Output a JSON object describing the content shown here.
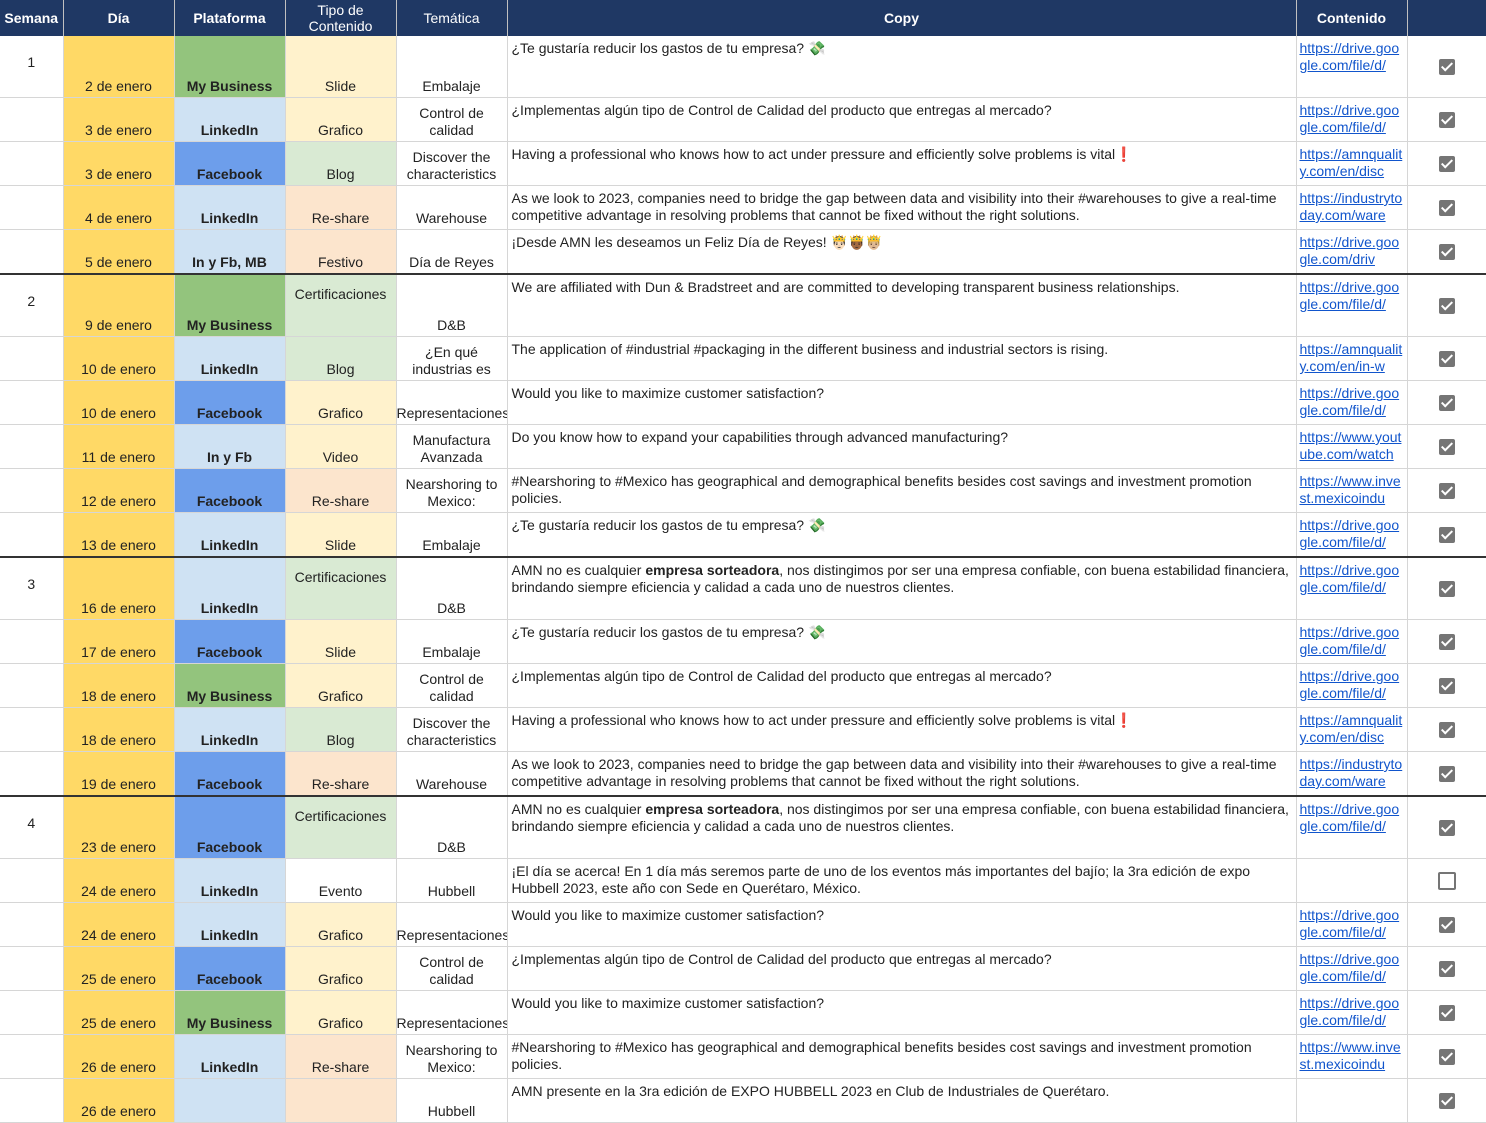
{
  "colors": {
    "header_bg": "#1f3864",
    "day_bg": "#ffd966",
    "my_business": "#93c47d",
    "linkedin": "#cfe2f3",
    "facebook": "#6d9eeb",
    "tipo_yellow": "#fff2cc",
    "tipo_green": "#d9ead3",
    "tipo_orange": "#fce5cd",
    "link": "#1155cc"
  },
  "headers": {
    "semana": "Semana",
    "dia": "Día",
    "plataforma": "Plataforma",
    "tipo": "Tipo de Contenido",
    "tematica": "Temática",
    "copy": "Copy",
    "contenido": "Contenido"
  },
  "rows": [
    {
      "semana": "1",
      "dia": "2 de enero",
      "plataforma": "My Business",
      "plat_color": "#93c47d",
      "tipo": "Slide",
      "tipo_color": "#fff2cc",
      "tematica": "Embalaje",
      "copy": "¿Te gustaría reducir los gastos de tu empresa? 💸",
      "contenido": "https://drive.google.com/file/d/",
      "checked": true
    },
    {
      "semana": "",
      "dia": "3 de enero",
      "plataforma": "LinkedIn",
      "plat_color": "#cfe2f3",
      "tipo": "Grafico",
      "tipo_color": "#fff2cc",
      "tematica": "Control de calidad",
      "copy": "¿Implementas algún tipo de Control de Calidad del producto que entregas al mercado?",
      "contenido": "https://drive.google.com/file/d/",
      "checked": true
    },
    {
      "semana": "",
      "dia": "3 de enero",
      "plataforma": "Facebook",
      "plat_color": "#6d9eeb",
      "tipo": "Blog",
      "tipo_color": "#d9ead3",
      "tematica": "Discover the characteristics",
      "copy": "Having a professional who knows how to act under pressure and efficiently solve problems is vital❗",
      "contenido": "https://amnquality.com/en/disc",
      "checked": true
    },
    {
      "semana": "",
      "dia": "4 de enero",
      "plataforma": "LinkedIn",
      "plat_color": "#cfe2f3",
      "tipo": "Re-share",
      "tipo_color": "#fce5cd",
      "tematica": "Warehouse",
      "copy": "As we look to 2023, companies need to bridge the gap between data and visibility into their #warehouses to give a real-time competitive advantage in resolving problems that cannot be fixed without the right solutions.",
      "contenido": "https://industrytoday.com/ware",
      "checked": true
    },
    {
      "semana": "",
      "dia": "5 de enero",
      "plataforma": "In y Fb, MB",
      "plat_color": "#cfe2f3",
      "tipo": "Festivo",
      "tipo_color": "#fce5cd",
      "tematica": "Día de Reyes",
      "copy": "¡Desde AMN les deseamos un Feliz Día de Reyes! 🤴🏻🤴🏾🤴🏼",
      "contenido": "https://drive.google.com/driv",
      "checked": true
    },
    {
      "semana": "2",
      "dia": "9 de enero",
      "plataforma": "My Business",
      "plat_color": "#93c47d",
      "tipo": "Certificaciones",
      "tipo_color": "#d9ead3",
      "tematica": "D&B",
      "copy": "We are affiliated with Dun & Bradstreet and are committed to developing transparent business relationships.",
      "contenido": "https://drive.google.com/file/d/",
      "checked": true
    },
    {
      "semana": "",
      "dia": "10 de enero",
      "plataforma": "LinkedIn",
      "plat_color": "#cfe2f3",
      "tipo": "Blog",
      "tipo_color": "#d9ead3",
      "tematica": "¿En qué industrias es",
      "copy": "The application of #industrial #packaging in the different business and industrial sectors is rising.",
      "contenido": "https://amnquality.com/en/in-w",
      "checked": true
    },
    {
      "semana": "",
      "dia": "10 de enero",
      "plataforma": "Facebook",
      "plat_color": "#6d9eeb",
      "tipo": "Grafico",
      "tipo_color": "#fff2cc",
      "tematica": "Representaciones",
      "copy": "Would you like to maximize customer satisfaction?",
      "contenido": "https://drive.google.com/file/d/",
      "checked": true
    },
    {
      "semana": "",
      "dia": "11 de enero",
      "plataforma": "In y Fb",
      "plat_color": "#cfe2f3",
      "tipo": "Video",
      "tipo_color": "#fff2cc",
      "tematica": "Manufactura Avanzada",
      "copy": "Do you know how to expand your capabilities through advanced manufacturing?",
      "contenido": "https://www.youtube.com/watch",
      "checked": true
    },
    {
      "semana": "",
      "dia": "12 de enero",
      "plataforma": "Facebook",
      "plat_color": "#6d9eeb",
      "tipo": "Re-share",
      "tipo_color": "#fce5cd",
      "tematica": "Nearshoring to Mexico:",
      "copy": "#Nearshoring to #Mexico has geographical and demographical benefits besides cost savings and investment promotion policies.",
      "contenido": "https://www.invest.mexicoindu",
      "checked": true
    },
    {
      "semana": "",
      "dia": "13 de enero",
      "plataforma": "LinkedIn",
      "plat_color": "#cfe2f3",
      "tipo": "Slide",
      "tipo_color": "#fff2cc",
      "tematica": "Embalaje",
      "copy": "¿Te gustaría reducir los gastos de tu empresa? 💸",
      "contenido": "https://drive.google.com/file/d/",
      "checked": true
    },
    {
      "semana": "3",
      "dia": "16 de enero",
      "plataforma": "LinkedIn",
      "plat_color": "#cfe2f3",
      "tipo": "Certificaciones",
      "tipo_color": "#d9ead3",
      "tematica": "D&B",
      "copy_pre": "AMN no es cualquier ",
      "copy_bold": "empresa sorteadora",
      "copy_post": ", nos distingimos por ser una empresa confiable, con buena estabilidad financiera, brindando siempre eficiencia y calidad a cada uno de nuestros clientes.",
      "contenido": "https://drive.google.com/file/d/",
      "checked": true
    },
    {
      "semana": "",
      "dia": "17 de enero",
      "plataforma": "Facebook",
      "plat_color": "#6d9eeb",
      "tipo": "Slide",
      "tipo_color": "#fff2cc",
      "tematica": "Embalaje",
      "copy": "¿Te gustaría reducir los gastos de tu empresa? 💸",
      "contenido": "https://drive.google.com/file/d/",
      "checked": true
    },
    {
      "semana": "",
      "dia": "18 de enero",
      "plataforma": "My Business",
      "plat_color": "#93c47d",
      "tipo": "Grafico",
      "tipo_color": "#fff2cc",
      "tematica": "Control de calidad",
      "copy": "¿Implementas algún tipo de Control de Calidad del producto que entregas al mercado?",
      "contenido": "https://drive.google.com/file/d/",
      "checked": true
    },
    {
      "semana": "",
      "dia": "18 de enero",
      "plataforma": "LinkedIn",
      "plat_color": "#cfe2f3",
      "tipo": "Blog",
      "tipo_color": "#d9ead3",
      "tematica": "Discover the characteristics",
      "copy": "Having a professional who knows how to act under pressure and efficiently solve problems is vital❗",
      "contenido": "https://amnquality.com/en/disc",
      "checked": true
    },
    {
      "semana": "",
      "dia": "19 de enero",
      "plataforma": "Facebook",
      "plat_color": "#6d9eeb",
      "tipo": "Re-share",
      "tipo_color": "#fce5cd",
      "tematica": "Warehouse",
      "copy": "As we look to 2023, companies need to bridge the gap between data and visibility into their #warehouses to give a real-time competitive advantage in resolving problems that cannot be fixed without the right solutions.",
      "contenido": "https://industrytoday.com/ware",
      "checked": true
    },
    {
      "semana": "4",
      "dia": "23 de enero",
      "plataforma": "Facebook",
      "plat_color": "#6d9eeb",
      "tipo": "Certificaciones",
      "tipo_color": "#d9ead3",
      "tematica": "D&B",
      "copy_pre": "AMN no es cualquier ",
      "copy_bold": "empresa sorteadora",
      "copy_post": ", nos distingimos por ser una empresa confiable, con buena estabilidad financiera, brindando siempre eficiencia y calidad a cada uno de nuestros clientes.",
      "contenido": "https://drive.google.com/file/d/",
      "checked": true
    },
    {
      "semana": "",
      "dia": "24 de enero",
      "plataforma": "LinkedIn",
      "plat_color": "#cfe2f3",
      "tipo": "Evento",
      "tipo_color": "#ffffff",
      "tematica": "Hubbell",
      "copy": "¡El día se acerca! En 1 día más seremos parte de uno de los eventos más importantes del bajío; la 3ra edición de expo Hubbell 2023, este año con Sede en Querétaro, México.",
      "contenido": "",
      "checked": false
    },
    {
      "semana": "",
      "dia": "24 de enero",
      "plataforma": "LinkedIn",
      "plat_color": "#cfe2f3",
      "tipo": "Grafico",
      "tipo_color": "#fff2cc",
      "tematica": "Representaciones",
      "copy": "Would you like to maximize customer satisfaction?",
      "contenido": "https://drive.google.com/file/d/",
      "checked": true
    },
    {
      "semana": "",
      "dia": "25 de enero",
      "plataforma": "Facebook",
      "plat_color": "#6d9eeb",
      "tipo": "Grafico",
      "tipo_color": "#fff2cc",
      "tematica": "Control de calidad",
      "copy": "¿Implementas algún tipo de Control de Calidad del producto que entregas al mercado?",
      "contenido": "https://drive.google.com/file/d/",
      "checked": true
    },
    {
      "semana": "",
      "dia": "25 de enero",
      "plataforma": "My Business",
      "plat_color": "#93c47d",
      "tipo": "Grafico",
      "tipo_color": "#fff2cc",
      "tematica": "Representaciones",
      "copy": "Would you like to maximize customer satisfaction?",
      "contenido": "https://drive.google.com/file/d/",
      "checked": true
    },
    {
      "semana": "",
      "dia": "26 de enero",
      "plataforma": "LinkedIn",
      "plat_color": "#cfe2f3",
      "tipo": "Re-share",
      "tipo_color": "#fce5cd",
      "tematica": "Nearshoring to Mexico:",
      "copy": "#Nearshoring to #Mexico has geographical and demographical benefits besides cost savings and investment promotion policies.",
      "contenido": "https://www.invest.mexicoindu",
      "checked": true
    },
    {
      "semana": "",
      "dia": "26 de enero",
      "plataforma": "",
      "plat_color": "#cfe2f3",
      "tipo": "",
      "tipo_color": "#fce5cd",
      "tematica": "Hubbell",
      "copy": "AMN presente en la 3ra edición de EXPO HUBBELL 2023 en Club de Industriales de Querétaro.",
      "contenido": "",
      "checked": true
    }
  ]
}
